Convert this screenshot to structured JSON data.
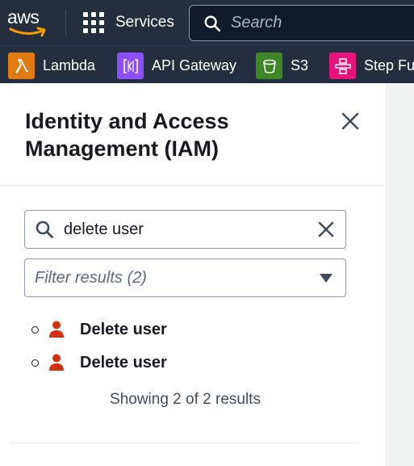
{
  "topnav": {
    "logo_text": "aws",
    "services_label": "Services",
    "search_placeholder": "Search"
  },
  "favorites": [
    {
      "label": "Lambda",
      "icon": "lambda-icon",
      "color": "#e07b12"
    },
    {
      "label": "API Gateway",
      "icon": "api-gateway-icon",
      "color": "#8c4fff"
    },
    {
      "label": "S3",
      "icon": "s3-bucket-icon",
      "color": "#3f8624"
    },
    {
      "label": "Step Fu",
      "icon": "step-functions-icon",
      "color": "#e7157b"
    }
  ],
  "panel": {
    "title_line1": "Identity and Access",
    "title_line2": "Management (IAM)",
    "search_value": "delete user",
    "filter_placeholder": "Filter results (2)",
    "results": [
      {
        "label": "Delete user",
        "icon": "user-icon"
      },
      {
        "label": "Delete user",
        "icon": "user-icon"
      }
    ],
    "showing_text": "Showing 2 of 2 results"
  },
  "colors": {
    "nav_bg": "#232f3e",
    "aws_orange": "#ff9900",
    "user_icon": "#d13212"
  }
}
